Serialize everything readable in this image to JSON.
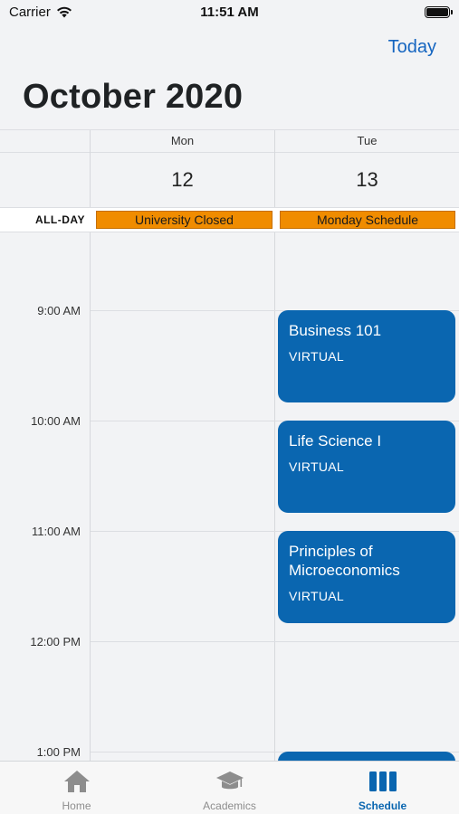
{
  "status_bar": {
    "carrier": "Carrier",
    "time": "11:51 AM"
  },
  "header": {
    "today_label": "Today",
    "month_title": "October 2020"
  },
  "days": [
    {
      "name": "Mon",
      "number": "12"
    },
    {
      "name": "Tue",
      "number": "13"
    }
  ],
  "all_day": {
    "label": "ALL-DAY",
    "events": [
      {
        "title": "University Closed",
        "day": "Mon"
      },
      {
        "title": "Monday Schedule",
        "day": "Tue"
      }
    ]
  },
  "time_slots": [
    "9:00 AM",
    "10:00 AM",
    "11:00 AM",
    "12:00 PM",
    "1:00 PM"
  ],
  "events": [
    {
      "title": "Business 101",
      "location": "VIRTUAL",
      "day": "Tue",
      "start": "9:00 AM"
    },
    {
      "title": "Life Science I",
      "location": "VIRTUAL",
      "day": "Tue",
      "start": "10:00 AM"
    },
    {
      "title": "Principles of Microeconomics",
      "location": "VIRTUAL",
      "day": "Tue",
      "start": "11:00 AM"
    },
    {
      "title": "",
      "location": "",
      "day": "Tue",
      "start": "1:00 PM"
    }
  ],
  "tabs": [
    {
      "label": "Home",
      "icon": "home-icon",
      "active": false
    },
    {
      "label": "Academics",
      "icon": "graduation-cap-icon",
      "active": false
    },
    {
      "label": "Schedule",
      "icon": "schedule-columns-icon",
      "active": true
    }
  ],
  "colors": {
    "accent": "#1565c0",
    "event_blue": "#0a66b0",
    "all_day_orange": "#f08c00",
    "background": "#f2f3f5"
  }
}
